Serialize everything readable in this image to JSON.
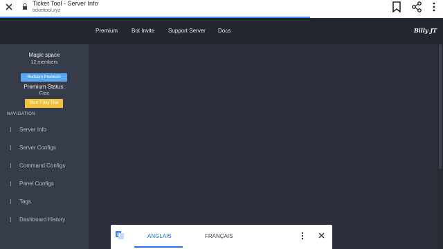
{
  "browser": {
    "title": "Ticket Tool - Server Info",
    "url": "tickettool.xyz",
    "load_progress": 0.7
  },
  "topnav": {
    "links": [
      "Premium",
      "Bot Invite",
      "Support Server",
      "Docs"
    ],
    "user": "Billy JT"
  },
  "sidebar": {
    "server_name": "Magic space",
    "members": "12 members",
    "redeem_label": "Redeem Premium",
    "premium_status_label": "Premium Status:",
    "premium_status_value": "Free",
    "trial_label": "Start 7 day Trial",
    "nav_heading": "NAVIGATION",
    "items": [
      {
        "label": "Server Info"
      },
      {
        "label": "Server Configs"
      },
      {
        "label": "Command Configs"
      },
      {
        "label": "Panel Configs"
      },
      {
        "label": "Tags"
      },
      {
        "label": "Dashboard History"
      }
    ]
  },
  "translate_bar": {
    "source_language": "ANGLAIS",
    "target_language": "FRANÇAIS"
  },
  "colors": {
    "accent_blue": "#5aa7f3",
    "trial_yellow": "#f0c33e",
    "sidebar_bg": "#373c4a",
    "main_bg": "#2a2f3a",
    "nav_bg": "#23272f",
    "translate_active": "#1a73e8"
  },
  "icons": [
    "close-icon",
    "lock-icon",
    "bookmark-icon",
    "share-icon",
    "more-vertical-icon",
    "google-translate-icon"
  ]
}
